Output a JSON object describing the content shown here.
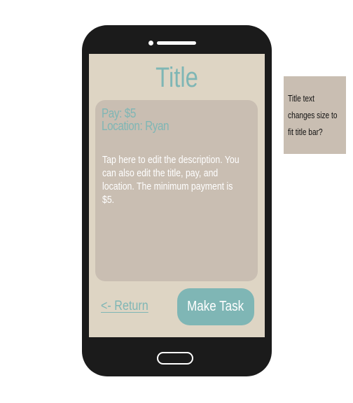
{
  "screen": {
    "title": "Title",
    "pay": "Pay: $5",
    "location": "Location: Ryan",
    "description": "Tap here to edit the description. You can also edit the title, pay, and location. The minimum payment is $5.",
    "return_label": "<- Return",
    "make_task_label": "Make Task"
  },
  "annotation": {
    "note": "Title text changes size to fit title bar?"
  },
  "colors": {
    "accent": "#7fb6b5",
    "screen_bg": "#ded5c4",
    "card_bg": "#c9beb2",
    "phone_body": "#1b1b1b"
  }
}
